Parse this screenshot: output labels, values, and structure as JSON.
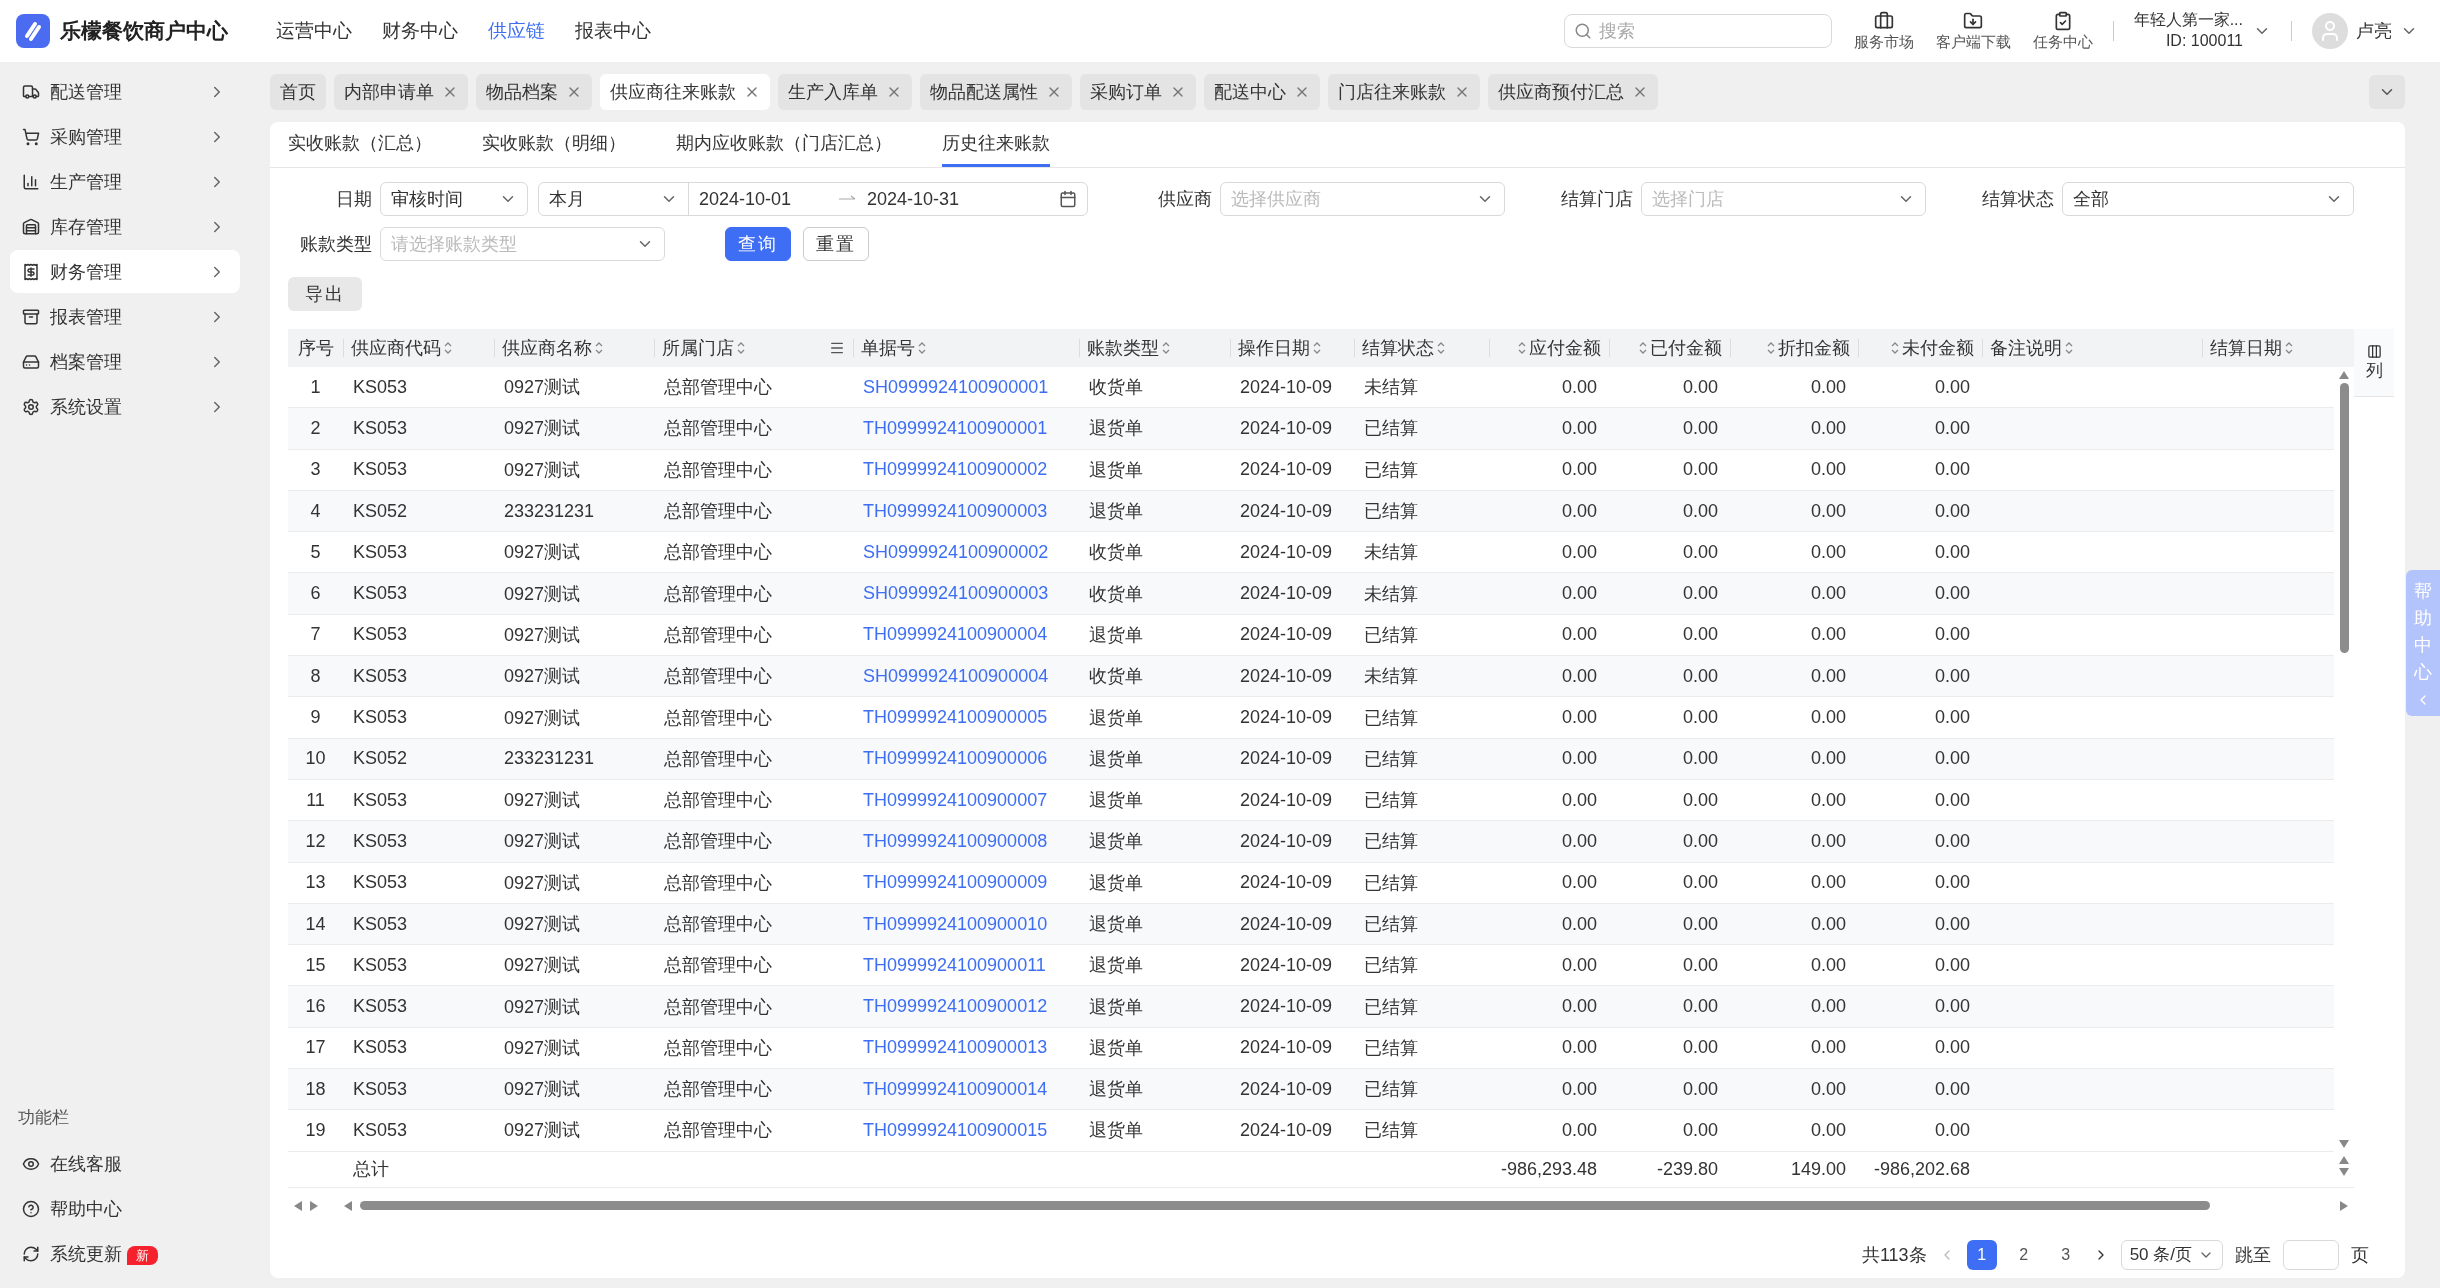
{
  "app": {
    "name": "乐檬餐饮商户中心"
  },
  "top_nav": [
    {
      "label": "运营中心",
      "selected": false
    },
    {
      "label": "财务中心",
      "selected": false
    },
    {
      "label": "供应链",
      "selected": true
    },
    {
      "label": "报表中心",
      "selected": false
    }
  ],
  "search": {
    "placeholder": "搜索"
  },
  "header_tools": [
    {
      "label": "服务市场"
    },
    {
      "label": "客户端下载"
    },
    {
      "label": "任务中心"
    }
  ],
  "account": {
    "name": "年轻人第一家...",
    "id": "ID: 100011"
  },
  "user": {
    "name": "卢亮"
  },
  "sidebar": {
    "items": [
      {
        "label": "配送管理",
        "selected": false
      },
      {
        "label": "采购管理",
        "selected": false
      },
      {
        "label": "生产管理",
        "selected": false
      },
      {
        "label": "库存管理",
        "selected": false
      },
      {
        "label": "财务管理",
        "selected": true
      },
      {
        "label": "报表管理",
        "selected": false
      },
      {
        "label": "档案管理",
        "selected": false
      },
      {
        "label": "系统设置",
        "selected": false
      }
    ],
    "section_title": "功能栏",
    "footer_items": [
      {
        "label": "在线客服"
      },
      {
        "label": "帮助中心"
      },
      {
        "label": "系统更新",
        "badge": "新"
      }
    ]
  },
  "open_tabs": [
    {
      "label": "首页",
      "selected": false,
      "closable": false
    },
    {
      "label": "内部申请单",
      "selected": false,
      "closable": true
    },
    {
      "label": "物品档案",
      "selected": false,
      "closable": true
    },
    {
      "label": "供应商往来账款",
      "selected": true,
      "closable": true
    },
    {
      "label": "生产入库单",
      "selected": false,
      "closable": true
    },
    {
      "label": "物品配送属性",
      "selected": false,
      "closable": true
    },
    {
      "label": "采购订单",
      "selected": false,
      "closable": true
    },
    {
      "label": "配送中心",
      "selected": false,
      "closable": true
    },
    {
      "label": "门店往来账款",
      "selected": false,
      "closable": true
    },
    {
      "label": "供应商预付汇总",
      "selected": false,
      "closable": true
    }
  ],
  "sub_tabs": [
    {
      "label": "实收账款（汇总）",
      "selected": false
    },
    {
      "label": "实收账款（明细）",
      "selected": false
    },
    {
      "label": "期内应收账款（门店汇总）",
      "selected": false
    },
    {
      "label": "历史往来账款",
      "selected": true
    }
  ],
  "filters": {
    "date": {
      "label": "日期",
      "basis": "审核时间",
      "period": "本月",
      "start": "2024-10-01",
      "end": "2024-10-31"
    },
    "supplier": {
      "label": "供应商",
      "placeholder": "选择供应商"
    },
    "store": {
      "label": "结算门店",
      "placeholder": "选择门店"
    },
    "status": {
      "label": "结算状态",
      "value": "全部"
    },
    "account_type": {
      "label": "账款类型",
      "placeholder": "请选择账款类型"
    },
    "buttons": [
      {
        "label": "查询",
        "kind": "primary"
      },
      {
        "label": "重置",
        "kind": "default"
      }
    ]
  },
  "export_button": "导出",
  "table": {
    "columns": [
      {
        "label": "序号",
        "sortable": false,
        "kind": "index",
        "menu": false
      },
      {
        "label": "供应商代码",
        "sortable": true,
        "kind": "text",
        "menu": false
      },
      {
        "label": "供应商名称",
        "sortable": true,
        "kind": "text",
        "menu": false
      },
      {
        "label": "所属门店",
        "sortable": true,
        "kind": "text",
        "menu": true
      },
      {
        "label": "单据号",
        "sortable": true,
        "kind": "link",
        "menu": false
      },
      {
        "label": "账款类型",
        "sortable": true,
        "kind": "text",
        "menu": false
      },
      {
        "label": "操作日期",
        "sortable": true,
        "kind": "text",
        "menu": false
      },
      {
        "label": "结算状态",
        "sortable": true,
        "kind": "text",
        "menu": false
      },
      {
        "label": "应付金额",
        "sortable": true,
        "kind": "amount",
        "menu": false
      },
      {
        "label": "已付金额",
        "sortable": true,
        "kind": "amount",
        "menu": false
      },
      {
        "label": "折扣金额",
        "sortable": true,
        "kind": "amount",
        "menu": false
      },
      {
        "label": "未付金额",
        "sortable": true,
        "kind": "amount",
        "menu": false
      },
      {
        "label": "备注说明",
        "sortable": true,
        "kind": "text",
        "menu": false
      },
      {
        "label": "结算日期",
        "sortable": true,
        "kind": "text",
        "menu": false
      }
    ],
    "rows": [
      [
        "1",
        "KS053",
        "0927测试",
        "总部管理中心",
        "SH0999924100900001",
        "收货单",
        "2024-10-09",
        "未结算",
        "0.00",
        "0.00",
        "0.00",
        "0.00"
      ],
      [
        "2",
        "KS053",
        "0927测试",
        "总部管理中心",
        "TH0999924100900001",
        "退货单",
        "2024-10-09",
        "已结算",
        "0.00",
        "0.00",
        "0.00",
        "0.00"
      ],
      [
        "3",
        "KS053",
        "0927测试",
        "总部管理中心",
        "TH0999924100900002",
        "退货单",
        "2024-10-09",
        "已结算",
        "0.00",
        "0.00",
        "0.00",
        "0.00"
      ],
      [
        "4",
        "KS052",
        "233231231",
        "总部管理中心",
        "TH0999924100900003",
        "退货单",
        "2024-10-09",
        "已结算",
        "0.00",
        "0.00",
        "0.00",
        "0.00"
      ],
      [
        "5",
        "KS053",
        "0927测试",
        "总部管理中心",
        "SH0999924100900002",
        "收货单",
        "2024-10-09",
        "未结算",
        "0.00",
        "0.00",
        "0.00",
        "0.00"
      ],
      [
        "6",
        "KS053",
        "0927测试",
        "总部管理中心",
        "SH0999924100900003",
        "收货单",
        "2024-10-09",
        "未结算",
        "0.00",
        "0.00",
        "0.00",
        "0.00"
      ],
      [
        "7",
        "KS053",
        "0927测试",
        "总部管理中心",
        "TH0999924100900004",
        "退货单",
        "2024-10-09",
        "已结算",
        "0.00",
        "0.00",
        "0.00",
        "0.00"
      ],
      [
        "8",
        "KS053",
        "0927测试",
        "总部管理中心",
        "SH0999924100900004",
        "收货单",
        "2024-10-09",
        "未结算",
        "0.00",
        "0.00",
        "0.00",
        "0.00"
      ],
      [
        "9",
        "KS053",
        "0927测试",
        "总部管理中心",
        "TH0999924100900005",
        "退货单",
        "2024-10-09",
        "已结算",
        "0.00",
        "0.00",
        "0.00",
        "0.00"
      ],
      [
        "10",
        "KS052",
        "233231231",
        "总部管理中心",
        "TH0999924100900006",
        "退货单",
        "2024-10-09",
        "已结算",
        "0.00",
        "0.00",
        "0.00",
        "0.00"
      ],
      [
        "11",
        "KS053",
        "0927测试",
        "总部管理中心",
        "TH0999924100900007",
        "退货单",
        "2024-10-09",
        "已结算",
        "0.00",
        "0.00",
        "0.00",
        "0.00"
      ],
      [
        "12",
        "KS053",
        "0927测试",
        "总部管理中心",
        "TH0999924100900008",
        "退货单",
        "2024-10-09",
        "已结算",
        "0.00",
        "0.00",
        "0.00",
        "0.00"
      ],
      [
        "13",
        "KS053",
        "0927测试",
        "总部管理中心",
        "TH0999924100900009",
        "退货单",
        "2024-10-09",
        "已结算",
        "0.00",
        "0.00",
        "0.00",
        "0.00"
      ],
      [
        "14",
        "KS053",
        "0927测试",
        "总部管理中心",
        "TH0999924100900010",
        "退货单",
        "2024-10-09",
        "已结算",
        "0.00",
        "0.00",
        "0.00",
        "0.00"
      ],
      [
        "15",
        "KS053",
        "0927测试",
        "总部管理中心",
        "TH0999924100900011",
        "退货单",
        "2024-10-09",
        "已结算",
        "0.00",
        "0.00",
        "0.00",
        "0.00"
      ],
      [
        "16",
        "KS053",
        "0927测试",
        "总部管理中心",
        "TH0999924100900012",
        "退货单",
        "2024-10-09",
        "已结算",
        "0.00",
        "0.00",
        "0.00",
        "0.00"
      ],
      [
        "17",
        "KS053",
        "0927测试",
        "总部管理中心",
        "TH0999924100900013",
        "退货单",
        "2024-10-09",
        "已结算",
        "0.00",
        "0.00",
        "0.00",
        "0.00"
      ],
      [
        "18",
        "KS053",
        "0927测试",
        "总部管理中心",
        "TH0999924100900014",
        "退货单",
        "2024-10-09",
        "已结算",
        "0.00",
        "0.00",
        "0.00",
        "0.00"
      ],
      [
        "19",
        "KS053",
        "0927测试",
        "总部管理中心",
        "TH0999924100900015",
        "退货单",
        "2024-10-09",
        "已结算",
        "0.00",
        "0.00",
        "0.00",
        "0.00"
      ]
    ],
    "totals": {
      "label": "总计",
      "amounts": [
        "-986,293.48",
        "-239.80",
        "149.00",
        "-986,202.68"
      ]
    },
    "column_settings": "列"
  },
  "pagination": {
    "total": "共113条",
    "pages": [
      {
        "label": "1",
        "selected": true
      },
      {
        "label": "2",
        "selected": false
      },
      {
        "label": "3",
        "selected": false
      }
    ],
    "page_size": "50 条/页",
    "jump_label": "跳至",
    "page_unit": "页"
  },
  "help_tab": {
    "label": "帮助中心"
  }
}
